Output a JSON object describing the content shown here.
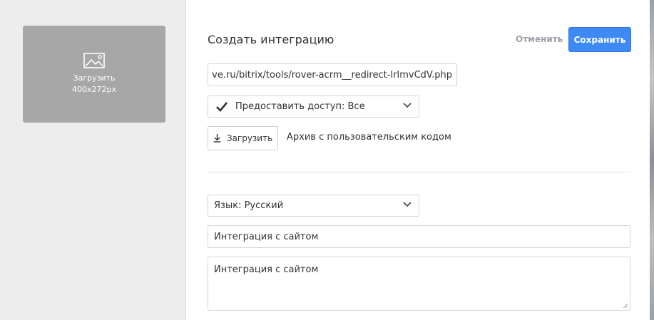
{
  "image_upload": {
    "label": "Загрузить",
    "size_hint": "400x272px"
  },
  "header": {
    "title": "Создать интеграцию",
    "cancel_label": "Отменить",
    "save_label": "Сохранить"
  },
  "form": {
    "url_value": "ve.ru/bitrix/tools/rover-acrm__redirect-lrImvCdV.php",
    "access_select": "Предоставить доступ: Все",
    "access_checked": true,
    "upload_label": "Загрузить",
    "archive_label": "Архив с пользовательским кодом",
    "language_select": "Язык: Русский",
    "name_value": "Интеграция с сайтом",
    "description_value": "Интеграция с сайтом"
  },
  "colors": {
    "save_button": "#3d8af7",
    "upload_box": "#a7a7a7",
    "left_panel": "#ededed"
  },
  "icons": {
    "image": "image-icon",
    "check": "check-icon",
    "chevron": "chevron-down-icon",
    "download": "download-icon",
    "resize": "resize-handle-icon"
  }
}
